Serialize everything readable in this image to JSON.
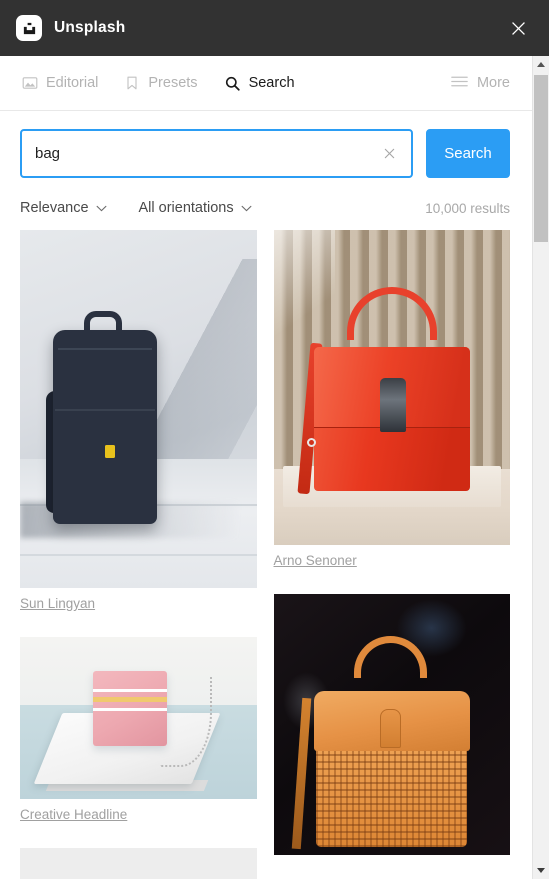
{
  "window": {
    "title": "Unsplash",
    "logo_icon": "unsplash-logo-icon",
    "close_icon": "close-icon",
    "titlebar_bg": "#323232"
  },
  "tabs": [
    {
      "id": "editorial",
      "label": "Editorial",
      "icon": "image-icon",
      "active": false
    },
    {
      "id": "presets",
      "label": "Presets",
      "icon": "bookmark-icon",
      "active": false
    },
    {
      "id": "search",
      "label": "Search",
      "icon": "search-icon",
      "active": true
    }
  ],
  "more": {
    "label": "More",
    "icon": "hamburger-icon"
  },
  "search": {
    "value": "bag",
    "placeholder": "Search",
    "clear_icon": "close-icon",
    "button_label": "Search",
    "accent_color": "#2b9df4"
  },
  "filters": {
    "sort": {
      "label": "Relevance",
      "icon": "chevron-down-icon"
    },
    "orientation": {
      "label": "All orientations",
      "icon": "chevron-down-icon"
    },
    "results_text": "10,000 results"
  },
  "results": {
    "left_column": [
      {
        "credit": "Sun Lingyan",
        "art": "ph-backpack",
        "subject": "navy backpack on tiled floor"
      },
      {
        "credit": "Creative Headline",
        "art": "ph-pinkbag",
        "subject": "pink chevron clutch with chain on white platform"
      }
    ],
    "right_column": [
      {
        "credit": "Arno Senoner",
        "art": "ph-redbag",
        "subject": "red patent leather handbag in front of beige curtain"
      },
      {
        "credit": "",
        "art": "ph-orangebag",
        "subject": "orange leather and wicker basket bag"
      }
    ],
    "loading_placeholder": true
  },
  "scrollbar": {
    "up_icon": "arrow-up-icon",
    "down_icon": "arrow-down-icon",
    "thumb": "scrollbar-thumb"
  }
}
